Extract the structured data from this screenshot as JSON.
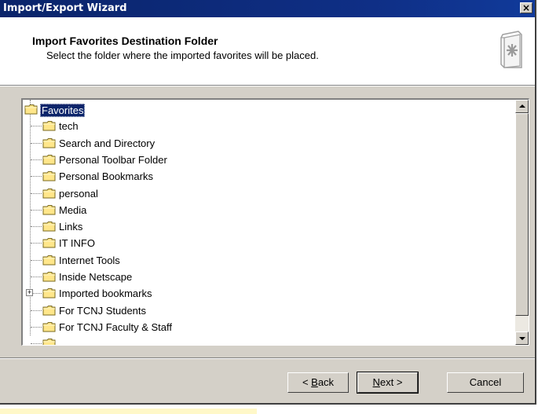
{
  "window": {
    "title": "Import/Export Wizard",
    "close_glyph": "×"
  },
  "header": {
    "title": "Import Favorites Destination Folder",
    "subtitle": "Select the folder where the imported favorites will be placed.",
    "icon": "wizard-book-icon"
  },
  "tree": {
    "root": "Favorites",
    "items": [
      "tech",
      "Search and Directory",
      "Personal Toolbar Folder",
      "Personal Bookmarks",
      "personal",
      "Media",
      "Links",
      "IT INFO",
      "Internet Tools",
      "Inside Netscape",
      "Imported bookmarks",
      "For TCNJ Students",
      "For TCNJ Faculty & Staff"
    ],
    "expandable_item": "Imported bookmarks",
    "selected": "Favorites"
  },
  "buttons": {
    "back_prefix": "< ",
    "back_key": "B",
    "back_rest": "ack",
    "next_key": "N",
    "next_rest": "ext >",
    "cancel": "Cancel"
  },
  "colors": {
    "titlebar": "#0a246a",
    "face": "#d4d0c8",
    "selection": "#0a246a"
  }
}
